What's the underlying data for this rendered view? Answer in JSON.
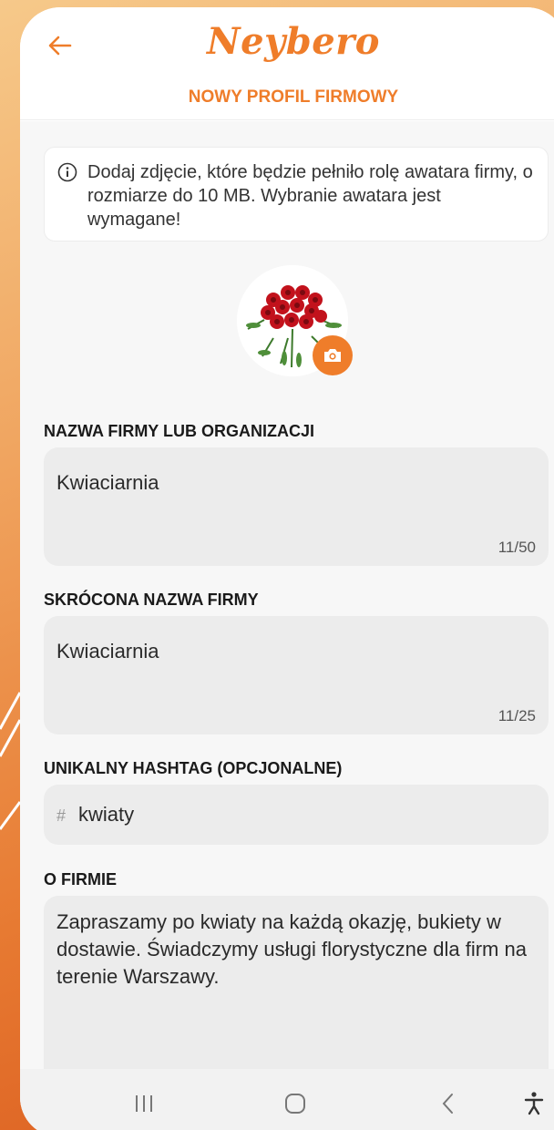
{
  "header": {
    "logo_text": "Neybero",
    "subtitle": "NOWY PROFIL FIRMOWY",
    "back_icon": "arrow-left-icon"
  },
  "info": {
    "icon": "info-circle-icon",
    "text": "Dodaj zdjęcie, które będzie pełniło rolę awatara firmy, o rozmiarze do 10 MB. Wybranie awatara jest wymagane!"
  },
  "avatar": {
    "image": "red-roses-bouquet",
    "camera_icon": "camera-icon"
  },
  "fields": {
    "company_name": {
      "label": "NAZWA FIRMY LUB ORGANIZACJI",
      "value": "Kwiaciarnia",
      "counter": "11/50"
    },
    "short_name": {
      "label": "SKRÓCONA NAZWA FIRMY",
      "value": "Kwiaciarnia",
      "counter": "11/25"
    },
    "hashtag": {
      "label": "UNIKALNY HASHTAG (OPCJONALNE)",
      "prefix": "#",
      "value": "kwiaty"
    },
    "about": {
      "label": "O FIRMIE",
      "value": "Zapraszamy po kwiaty na każdą okazję, bukiety w dostawie. Świadczymy usługi florystyczne dla firm na terenie Warszawy."
    }
  },
  "navbar": {
    "recents_icon": "recents-icon",
    "home_icon": "home-icon",
    "back_icon": "back-chevron-icon",
    "accessibility_icon": "accessibility-icon"
  },
  "colors": {
    "accent": "#ef7d2a",
    "field_bg": "#ececec",
    "page_bg": "#f7f7f7"
  }
}
